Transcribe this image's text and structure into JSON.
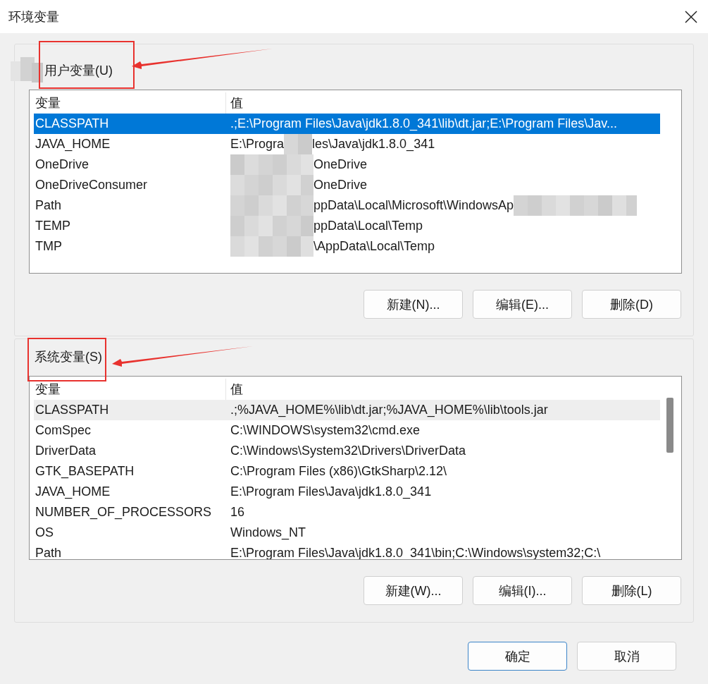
{
  "window": {
    "title": "环境变量"
  },
  "groups": [
    {
      "label": "用户变量(U)",
      "label_blurred": true,
      "highlighted": true,
      "columns": [
        "变量",
        "值"
      ],
      "focused": true,
      "scrollbar": false,
      "rows": [
        {
          "name": "CLASSPATH",
          "selected": true,
          "value": [
            {
              "kind": "text",
              "text": ".;E:\\Program Files\\Java\\jdk1.8.0_341\\lib\\dt.jar;E:\\Program Files\\Jav..."
            }
          ]
        },
        {
          "name": "JAVA_HOME",
          "selected": false,
          "value": [
            {
              "kind": "text",
              "text": "E:\\Progra"
            },
            {
              "kind": "blur-small"
            },
            {
              "kind": "text",
              "text": "les\\Java\\jdk1.8.0_341"
            }
          ]
        },
        {
          "name": "OneDrive",
          "selected": false,
          "value": [
            {
              "kind": "blur-wide"
            },
            {
              "kind": "text",
              "text": "OneDrive"
            }
          ]
        },
        {
          "name": "OneDriveConsumer",
          "selected": false,
          "value": [
            {
              "kind": "blur-wide"
            },
            {
              "kind": "text",
              "text": "OneDrive"
            }
          ]
        },
        {
          "name": "Path",
          "selected": false,
          "value": [
            {
              "kind": "blur-wide"
            },
            {
              "kind": "text",
              "text": "ppData\\Local\\Microsoft\\WindowsAp"
            },
            {
              "kind": "blur-trailing"
            }
          ]
        },
        {
          "name": "TEMP",
          "selected": false,
          "value": [
            {
              "kind": "blur-wide"
            },
            {
              "kind": "text",
              "text": "ppData\\Local\\Temp"
            }
          ]
        },
        {
          "name": "TMP",
          "selected": false,
          "value": [
            {
              "kind": "blur-wide"
            },
            {
              "kind": "text",
              "text": "\\AppData\\Local\\Temp"
            }
          ]
        }
      ],
      "buttons": [
        "新建(N)...",
        "编辑(E)...",
        "删除(D)"
      ]
    },
    {
      "label": "系统变量(S)",
      "label_blurred": false,
      "highlighted": true,
      "columns": [
        "变量",
        "值"
      ],
      "focused": false,
      "scrollbar": true,
      "rows": [
        {
          "name": "CLASSPATH",
          "selected": true,
          "value": [
            {
              "kind": "text",
              "text": ".;%JAVA_HOME%\\lib\\dt.jar;%JAVA_HOME%\\lib\\tools.jar"
            }
          ]
        },
        {
          "name": "ComSpec",
          "selected": false,
          "value": [
            {
              "kind": "text",
              "text": "C:\\WINDOWS\\system32\\cmd.exe"
            }
          ]
        },
        {
          "name": "DriverData",
          "selected": false,
          "value": [
            {
              "kind": "text",
              "text": "C:\\Windows\\System32\\Drivers\\DriverData"
            }
          ]
        },
        {
          "name": "GTK_BASEPATH",
          "selected": false,
          "value": [
            {
              "kind": "text",
              "text": "C:\\Program Files (x86)\\GtkSharp\\2.12\\"
            }
          ]
        },
        {
          "name": "JAVA_HOME",
          "selected": false,
          "value": [
            {
              "kind": "text",
              "text": "E:\\Program Files\\Java\\jdk1.8.0_341"
            }
          ]
        },
        {
          "name": "NUMBER_OF_PROCESSORS",
          "selected": false,
          "value": [
            {
              "kind": "text",
              "text": "16"
            }
          ]
        },
        {
          "name": "OS",
          "selected": false,
          "value": [
            {
              "kind": "text",
              "text": "Windows_NT"
            }
          ]
        },
        {
          "name": "Path",
          "selected": false,
          "value": [
            {
              "kind": "text",
              "text": "E:\\Program Files\\Java\\jdk1.8.0_341\\bin;C:\\Windows\\system32;C:\\"
            }
          ]
        }
      ],
      "buttons": [
        "新建(W)...",
        "编辑(I)...",
        "删除(L)"
      ]
    }
  ],
  "footer": [
    {
      "label": "确定",
      "default": true
    },
    {
      "label": "取消",
      "default": false
    }
  ]
}
